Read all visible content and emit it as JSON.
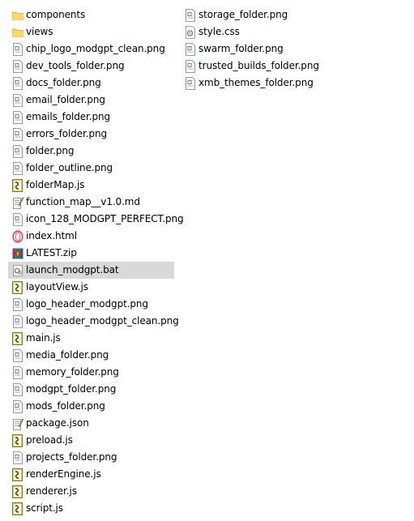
{
  "file_list": {
    "column_left": [
      {
        "name": "components",
        "icon": "folder-icon"
      },
      {
        "name": "views",
        "icon": "folder-icon"
      },
      {
        "name": "chip_logo_modgpt_clean.png",
        "icon": "png-file-icon"
      },
      {
        "name": "dev_tools_folder.png",
        "icon": "png-file-icon"
      },
      {
        "name": "docs_folder.png",
        "icon": "png-file-icon"
      },
      {
        "name": "email_folder.png",
        "icon": "png-file-icon"
      },
      {
        "name": "emails_folder.png",
        "icon": "png-file-icon"
      },
      {
        "name": "errors_folder.png",
        "icon": "png-file-icon"
      },
      {
        "name": "folder.png",
        "icon": "png-file-icon"
      },
      {
        "name": "folder_outline.png",
        "icon": "png-file-icon"
      },
      {
        "name": "folderMap.js",
        "icon": "js-file-icon"
      },
      {
        "name": "function_map__v1.0.md",
        "icon": "md-file-icon"
      },
      {
        "name": "icon_128_MODGPT_PERFECT.png",
        "icon": "png-file-icon"
      },
      {
        "name": "index.html",
        "icon": "html-file-icon"
      },
      {
        "name": "LATEST.zip",
        "icon": "zip-file-icon"
      },
      {
        "name": "launch_modgpt.bat",
        "icon": "bat-file-icon",
        "selected": true
      },
      {
        "name": "layoutView.js",
        "icon": "js-file-icon"
      },
      {
        "name": "logo_header_modgpt.png",
        "icon": "png-file-icon"
      },
      {
        "name": "logo_header_modgpt_clean.png",
        "icon": "png-file-icon"
      },
      {
        "name": "main.js",
        "icon": "js-file-icon"
      },
      {
        "name": "media_folder.png",
        "icon": "png-file-icon"
      },
      {
        "name": "memory_folder.png",
        "icon": "png-file-icon"
      },
      {
        "name": "modgpt_folder.png",
        "icon": "png-file-icon"
      },
      {
        "name": "mods_folder.png",
        "icon": "png-file-icon"
      },
      {
        "name": "package.json",
        "icon": "json-file-icon"
      },
      {
        "name": "preload.js",
        "icon": "js-file-icon"
      },
      {
        "name": "projects_folder.png",
        "icon": "png-file-icon"
      },
      {
        "name": "renderEngine.js",
        "icon": "js-file-icon"
      },
      {
        "name": "renderer.js",
        "icon": "js-file-icon"
      },
      {
        "name": "script.js",
        "icon": "js-file-icon"
      }
    ],
    "column_right": [
      {
        "name": "storage_folder.png",
        "icon": "png-file-icon"
      },
      {
        "name": "style.css",
        "icon": "css-file-icon"
      },
      {
        "name": "swarm_folder.png",
        "icon": "png-file-icon"
      },
      {
        "name": "trusted_builds_folder.png",
        "icon": "png-file-icon"
      },
      {
        "name": "xmb_themes_folder.png",
        "icon": "png-file-icon"
      }
    ]
  },
  "colors": {
    "selection_background": "#d9d9d9",
    "folder_yellow": "#f5cd5a",
    "png_blue": "#2c6fc9",
    "js_yellow": "#e8d44d"
  }
}
